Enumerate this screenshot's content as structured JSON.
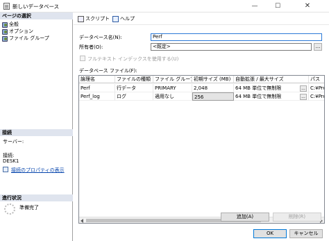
{
  "window": {
    "title": "新しいデータベース",
    "min": "—",
    "max": "☐",
    "close": "✕"
  },
  "left": {
    "page_select_header": "ページの選択",
    "pages": [
      {
        "label": "全般",
        "icon": "page-icon"
      },
      {
        "label": "オプション",
        "icon": "page-icon"
      },
      {
        "label": "ファイル グループ",
        "icon": "page-icon"
      }
    ],
    "connection_header": "接続",
    "server_label": "サーバー:",
    "connection_label": "接続:",
    "connection_value": "DESK1",
    "connection_props_link": "接続のプロパティの表示",
    "progress_header": "進行状況",
    "progress_status": "準備完了"
  },
  "toolbar": {
    "script_label": "スクリプト",
    "help_label": "ヘルプ"
  },
  "form": {
    "db_name_label": "データベース名(N):",
    "db_name_value": "Perf",
    "owner_label": "所有者(O):",
    "owner_value": "<既定>",
    "owner_button": "...",
    "fulltext_label": "フルテキスト インデックスを使用する(U)",
    "files_label": "データベース ファイル(F):"
  },
  "grid": {
    "columns": [
      "論理名",
      "ファイルの種類",
      "ファイル グループ",
      "初期サイズ (MB)",
      "自動拡張 / 最大サイズ",
      "パス"
    ],
    "rows": [
      {
        "name": "Perf",
        "type": "行データ",
        "group": "PRIMARY",
        "size": "2,048",
        "growth": "64 MB 単位で無制限",
        "path": "C:¥Prog"
      },
      {
        "name": "Perf_log",
        "type": "ログ",
        "group": "適用なし",
        "size": "256",
        "growth": "64 MB 単位で無制限",
        "path": "C:¥Prog"
      }
    ],
    "cell_button": "..."
  },
  "buttons": {
    "add": "追加(A)",
    "remove": "削除(R)",
    "ok": "OK",
    "cancel": "キャンセル"
  }
}
